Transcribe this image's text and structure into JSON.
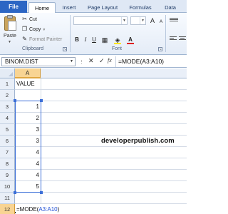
{
  "tabs": {
    "file": "File",
    "home": "Home",
    "insert": "Insert",
    "page_layout": "Page Layout",
    "formulas": "Formulas",
    "data": "Data"
  },
  "clipboard": {
    "paste": "Paste",
    "cut": "Cut",
    "copy": "Copy",
    "format_painter": "Format Painter",
    "group_label": "Clipboard"
  },
  "font_group": {
    "group_label": "Font",
    "bold": "B",
    "italic": "I",
    "underline": "U"
  },
  "formula_bar": {
    "name_box": "BINOM.DIST",
    "cancel": "✕",
    "enter": "✓",
    "fx": "fx",
    "formula": "=MODE(A3:A10)"
  },
  "columns": [
    "A"
  ],
  "rows": [
    "1",
    "2",
    "3",
    "4",
    "5",
    "6",
    "7",
    "8",
    "9",
    "10",
    "11",
    "12"
  ],
  "cells": {
    "A1": "VALUE",
    "A3": "1",
    "A4": "2",
    "A5": "3",
    "A6": "3",
    "A7": "4",
    "A8": "4",
    "A9": "4",
    "A10": "5",
    "A12_prefix": "=MODE(",
    "A12_ref": "A3:A10",
    "A12_suffix": ")"
  },
  "watermark": "developerpublish.com",
  "colors": {
    "file_tab": "#2c66c4",
    "selected_header": "#f8d493",
    "range_border": "#3c6fd8",
    "range_ref_text": "#1f4fd6"
  }
}
